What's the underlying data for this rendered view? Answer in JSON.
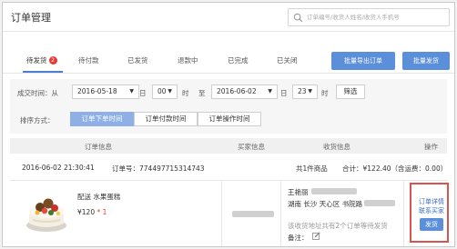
{
  "page": {
    "title": "订单管理"
  },
  "search": {
    "placeholder": "订单编号/收货人姓名/收货人手机号"
  },
  "tabs": [
    {
      "label": "待发货",
      "badge": "2"
    },
    {
      "label": "待付款"
    },
    {
      "label": "已发货"
    },
    {
      "label": "退款中"
    },
    {
      "label": "已完成"
    },
    {
      "label": "已关闭"
    }
  ],
  "actions": {
    "export_label": "批量导出订单",
    "ship_label": "批量发货"
  },
  "filters": {
    "time_label": "成交时间：从",
    "start_date": "2016-05-18",
    "day_label1": "日",
    "start_hour": "00",
    "hour_label1": "时",
    "to_label": "至",
    "end_date": "2016-06-02",
    "day_label2": "日",
    "end_hour": "23",
    "hour_label2": "时",
    "filter_button": "筛选",
    "sort_label": "排序方式：",
    "sort_options": [
      "订单下单时间",
      "订单付款时间",
      "订单操作时间"
    ]
  },
  "table": {
    "headers": [
      "订单信息",
      "买家信息",
      "收货信息",
      "操作"
    ]
  },
  "order": {
    "datetime": "2016-06-02 21:30:41",
    "order_no": "订单号：774497715314743",
    "count": "共1件商品",
    "total": "合计：¥122.40（含运费：0.00）",
    "product_name": "配送 水果蛋糕",
    "price": "¥120",
    "qty": "* 1",
    "receiver_name": "王艳丽",
    "address": "湖南 长沙 天心区 书院路",
    "note": "该收货地址共有2个订单等待发货",
    "remark_label": "备注：",
    "links": [
      "订单详情",
      "联系买家"
    ],
    "ship_button": "发货"
  },
  "colors": {
    "accent": "#5b8fd9",
    "badge": "#e53935",
    "highlight": "#d9534f",
    "link": "#3b6fc8"
  }
}
